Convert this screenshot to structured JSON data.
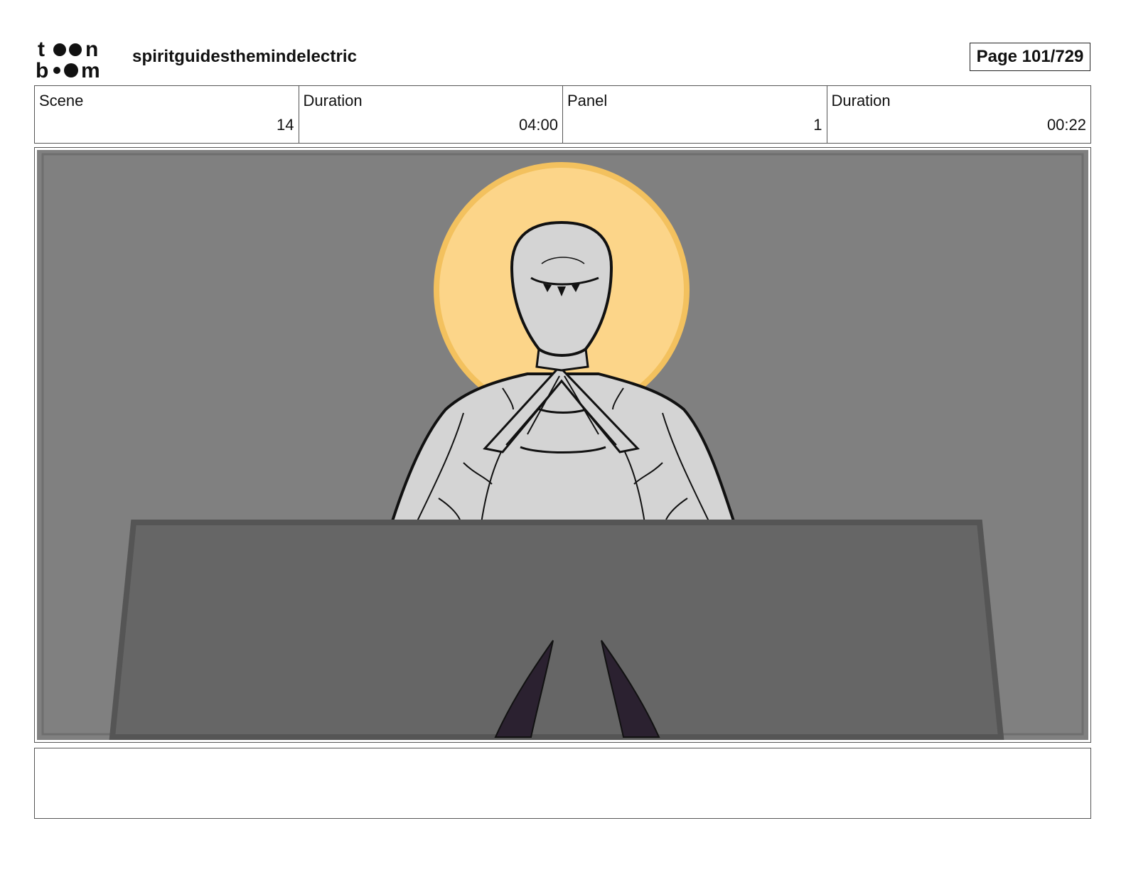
{
  "header": {
    "logo": "toon boom",
    "project_title": "spiritguidesthemindelectric",
    "page_label": "Page 101/729"
  },
  "info": {
    "scene_label": "Scene",
    "scene_value": "14",
    "scene_duration_label": "Duration",
    "scene_duration_value": "04:00",
    "panel_label": "Panel",
    "panel_value": "1",
    "panel_duration_label": "Duration",
    "panel_duration_value": "00:22"
  },
  "notes": {
    "text": ""
  },
  "colors": {
    "background": "#808080",
    "halo": "#fcd589",
    "halo_rim": "#f3c15e",
    "figure": "#d4d4d4",
    "desk": "#666666",
    "desk_edge": "#555555",
    "horns": "#2b2130"
  }
}
